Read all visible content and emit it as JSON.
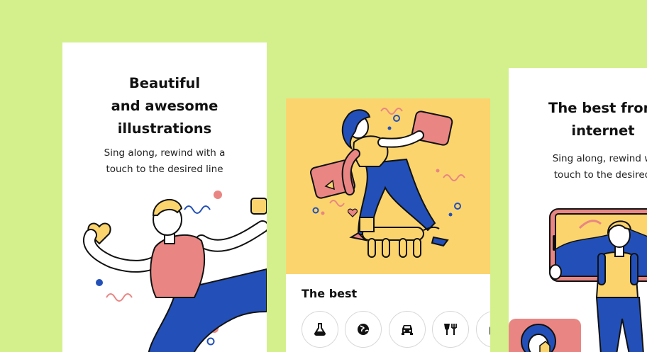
{
  "cards": [
    {
      "title": "Beautiful\nand awesome\nillustrations",
      "subtitle": "Sing along, rewind with a\ntouch to the desired line"
    },
    {
      "section_heading": "The best",
      "categories": [
        {
          "icon": "flask-icon"
        },
        {
          "icon": "globe-icon"
        },
        {
          "icon": "car-icon"
        },
        {
          "icon": "fork-knife-icon"
        },
        {
          "icon": "jar-icon"
        }
      ]
    },
    {
      "title": "The best from\ninternet",
      "subtitle": "Sing along, rewind w\ntouch to the desired"
    }
  ],
  "colors": {
    "background": "#d4f08c",
    "card": "#ffffff",
    "illustration_bg": "#fbd46e",
    "blue": "#2350b8",
    "pink": "#e98683",
    "yellow": "#fbd46e"
  }
}
